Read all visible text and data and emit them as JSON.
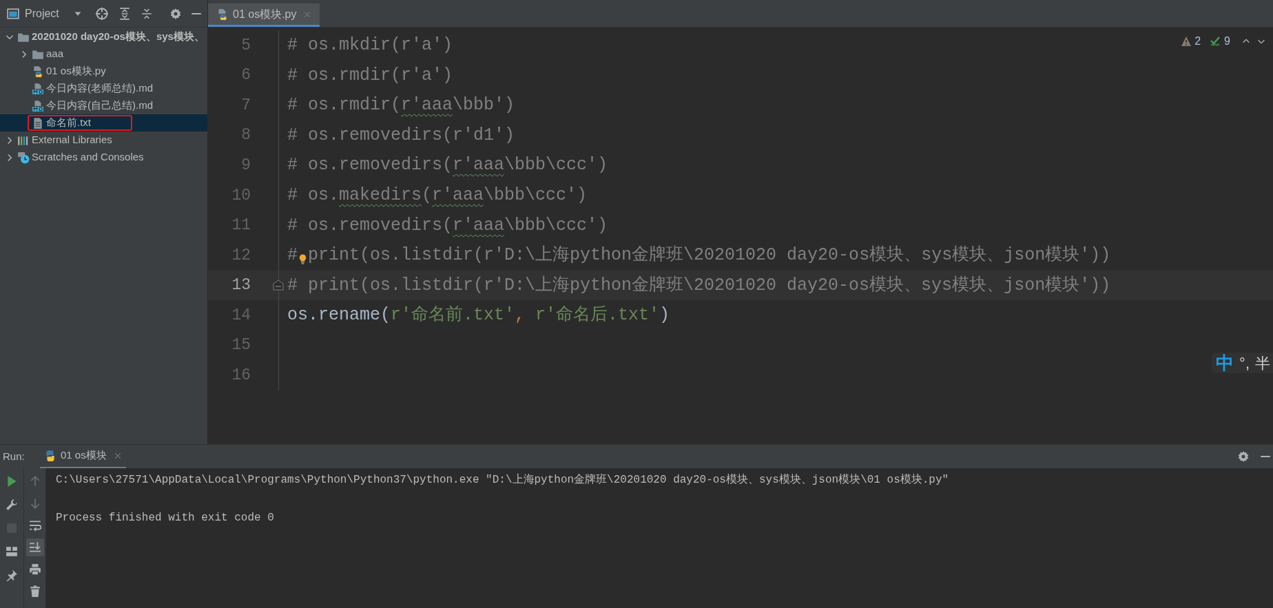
{
  "project_panel": {
    "title": "Project",
    "tree": [
      {
        "label": "20201020 day20-os模块、sys模块、",
        "kind": "root",
        "expanded": true,
        "selected": false,
        "annotated": false,
        "children": [
          {
            "label": "aaa",
            "kind": "folder",
            "expanded": false,
            "selected": false,
            "annotated": false
          },
          {
            "label": "01 os模块.py",
            "kind": "python",
            "selected": false,
            "annotated": false
          },
          {
            "label": "今日内容(老师总结).md",
            "kind": "markdown",
            "selected": false,
            "annotated": false
          },
          {
            "label": "今日内容(自己总结).md",
            "kind": "markdown",
            "selected": false,
            "annotated": false
          },
          {
            "label": "命名前.txt",
            "kind": "text",
            "selected": true,
            "annotated": true
          }
        ]
      },
      {
        "label": "External Libraries",
        "kind": "libraries",
        "expanded": false,
        "selected": false,
        "annotated": false
      },
      {
        "label": "Scratches and Consoles",
        "kind": "scratches",
        "expanded": false,
        "selected": false,
        "annotated": false
      }
    ]
  },
  "editor": {
    "tabs": [
      {
        "label": "01 os模块.py",
        "selected": true
      }
    ],
    "inspections": {
      "warnings": "2",
      "typos": "9"
    },
    "lines": [
      {
        "number": "5",
        "current": false,
        "tokens": [
          {
            "text": "# os.mkdir(r'a')",
            "kind": "comment"
          }
        ]
      },
      {
        "number": "6",
        "current": false,
        "tokens": [
          {
            "text": "# os.rmdir(r'a')",
            "kind": "comment"
          }
        ]
      },
      {
        "number": "7",
        "current": false,
        "tokens": [
          {
            "text": "# os.rmdir(",
            "kind": "comment"
          },
          {
            "text": "r'aaa",
            "kind": "comment",
            "typo": true
          },
          {
            "text": "\\bbb')",
            "kind": "comment"
          }
        ]
      },
      {
        "number": "8",
        "current": false,
        "tokens": [
          {
            "text": "# os.removedirs(r'd1')",
            "kind": "comment"
          }
        ]
      },
      {
        "number": "9",
        "current": false,
        "tokens": [
          {
            "text": "# os.removedirs(",
            "kind": "comment"
          },
          {
            "text": "r'aaa",
            "kind": "comment",
            "typo": true
          },
          {
            "text": "\\bbb\\ccc')",
            "kind": "comment"
          }
        ]
      },
      {
        "number": "10",
        "current": false,
        "tokens": [
          {
            "text": "# os.",
            "kind": "comment"
          },
          {
            "text": "makedirs",
            "kind": "comment",
            "typo": true
          },
          {
            "text": "(",
            "kind": "comment"
          },
          {
            "text": "r'aaa",
            "kind": "comment",
            "typo": true
          },
          {
            "text": "\\bbb\\ccc')",
            "kind": "comment"
          }
        ]
      },
      {
        "number": "11",
        "current": false,
        "tokens": [
          {
            "text": "# os.removedirs(",
            "kind": "comment"
          },
          {
            "text": "r'aaa",
            "kind": "comment",
            "typo": true
          },
          {
            "text": "\\bbb\\ccc')",
            "kind": "comment"
          }
        ]
      },
      {
        "number": "12",
        "current": false,
        "bulb": true,
        "tokens": [
          {
            "text": "#",
            "kind": "comment"
          },
          {
            "text": "print(os.listdir(r'D:\\上海python金牌班\\20201020 day20-os模块、sys模块、json模块'))",
            "kind": "comment"
          }
        ]
      },
      {
        "number": "13",
        "current": true,
        "fold": true,
        "tokens": [
          {
            "text": "# print(os.listdir(r'D:\\上海python金牌班\\20201020 day20-os模块、sys模块、json模块'))",
            "kind": "comment"
          }
        ]
      },
      {
        "number": "14",
        "current": false,
        "tokens": [
          {
            "text": "os.rename(",
            "kind": "plain"
          },
          {
            "text": "r'命名前.txt'",
            "kind": "string"
          },
          {
            "text": ", ",
            "kind": "keyword"
          },
          {
            "text": "r'命名后.txt'",
            "kind": "string"
          },
          {
            "text": ")",
            "kind": "plain"
          }
        ]
      },
      {
        "number": "15",
        "current": false
      },
      {
        "number": "16",
        "current": false
      }
    ],
    "ime": {
      "mode": "中",
      "punctuation": "°,",
      "width": "半"
    }
  },
  "run_panel": {
    "label": "Run:",
    "tabs": [
      {
        "label": "01 os模块",
        "selected": true
      }
    ],
    "toolbar_left": [
      {
        "kind": "run",
        "disabled": false
      },
      {
        "kind": "wrench",
        "disabled": false
      },
      {
        "kind": "stop",
        "disabled": true
      },
      {
        "kind": "layout",
        "disabled": false
      },
      {
        "kind": "pin",
        "disabled": false
      }
    ],
    "toolbar_right": [
      {
        "kind": "up",
        "disabled": true
      },
      {
        "kind": "down",
        "disabled": true
      },
      {
        "kind": "wrap",
        "disabled": false,
        "on": false
      },
      {
        "kind": "scroll-end",
        "disabled": false,
        "on": true
      },
      {
        "kind": "print",
        "disabled": false,
        "on": false
      },
      {
        "kind": "trash",
        "disabled": false,
        "on": false
      }
    ],
    "output": [
      {
        "text": "C:\\Users\\27571\\AppData\\Local\\Programs\\Python\\Python37\\python.exe \"D:\\上海python金牌班\\20201020 day20-os模块、sys模块、json模块\\01 os模块.py\"",
        "kind": "command"
      },
      {
        "text": "Process finished with exit code 0",
        "kind": "status"
      }
    ]
  }
}
